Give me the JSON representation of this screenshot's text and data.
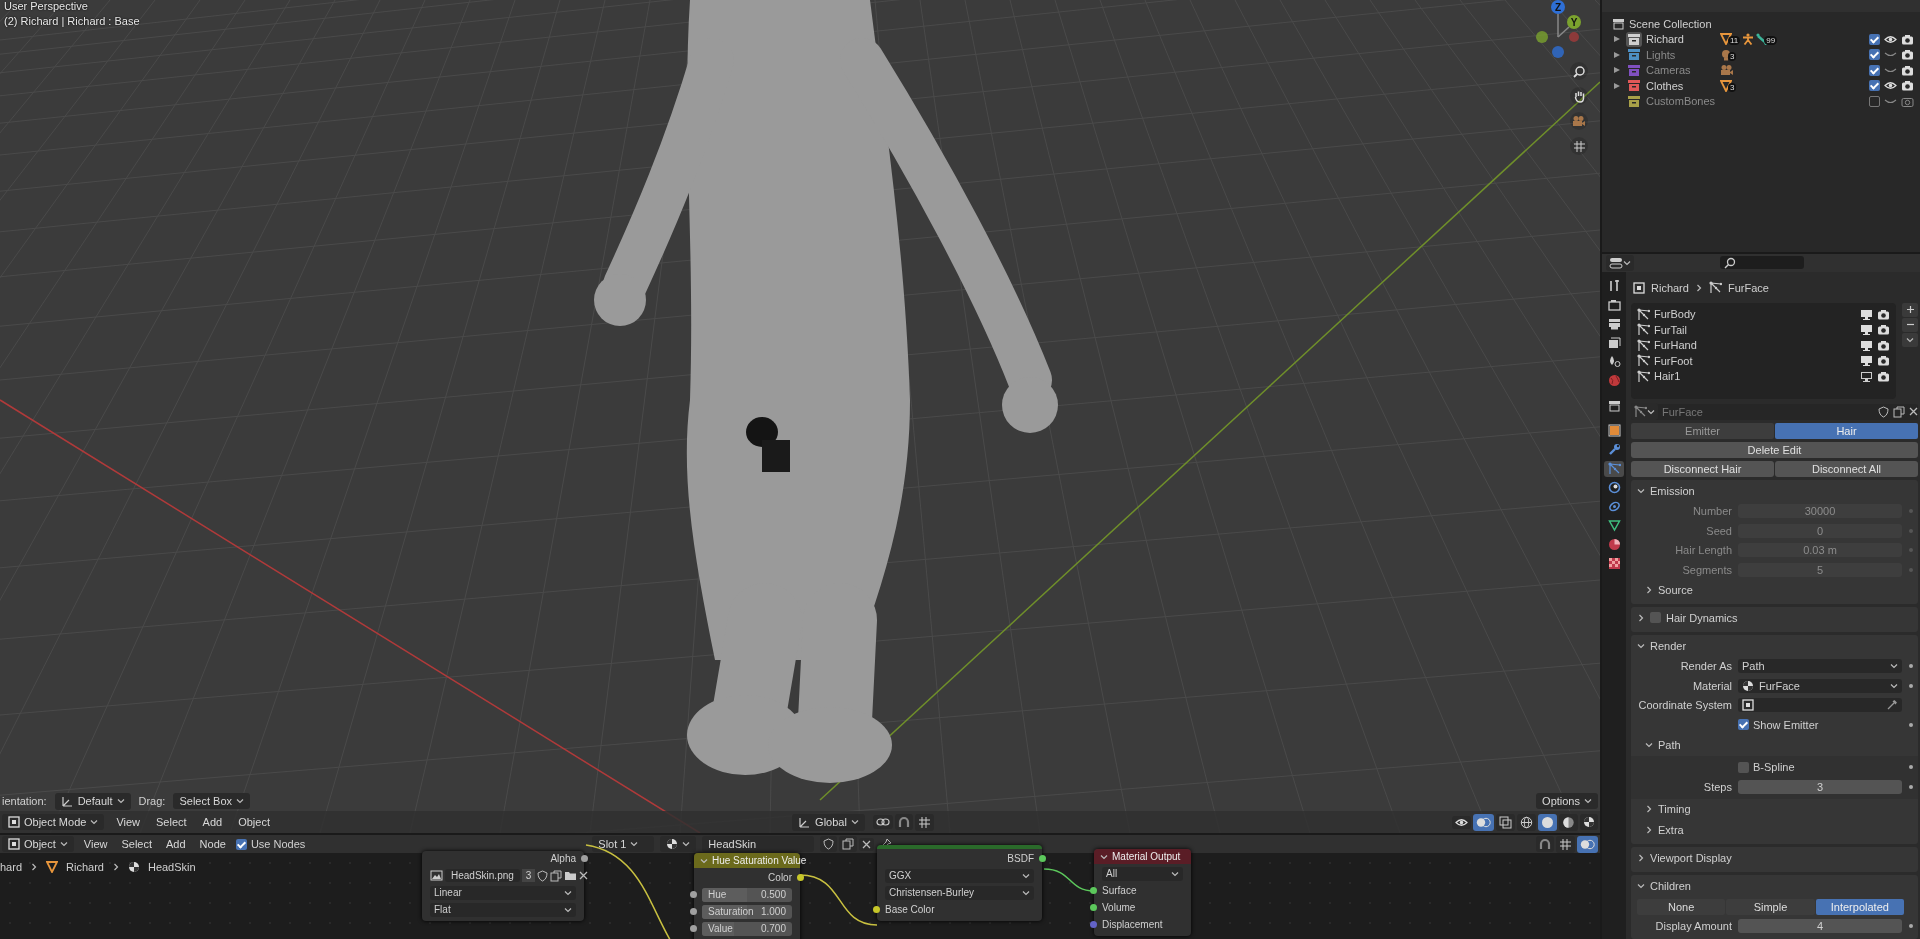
{
  "viewport": {
    "overlay": {
      "title": "User Perspective",
      "info": "(2) Richard | Richard : Base"
    },
    "gizmo": [
      {
        "label": "Z",
        "color": "#2e6fd6"
      },
      {
        "label": "Y",
        "color": "#7ba22e"
      }
    ],
    "tool_settings": {
      "orientation_label": "ientation:",
      "orientation": "Default",
      "drag_label": "Drag:",
      "drag": "Select Box",
      "options": "Options"
    },
    "header": {
      "mode": "Object Mode",
      "menus": [
        "View",
        "Select",
        "Add",
        "Object"
      ],
      "transform": "Global"
    }
  },
  "node_editor": {
    "header": {
      "editor": "Object",
      "menus": [
        "View",
        "Select",
        "Add",
        "Node"
      ],
      "use_nodes": {
        "label": "Use Nodes",
        "checked": true
      },
      "slot": "Slot 1",
      "material": "HeadSkin"
    },
    "breadcrumbs": [
      {
        "kind": "text",
        "label": "hard"
      },
      {
        "kind": "mesh",
        "label": "Richard"
      },
      {
        "kind": "material",
        "label": "HeadSkin"
      }
    ],
    "nodes": [
      {
        "kind": "image",
        "outputs": [
          "Alpha"
        ],
        "image": "HeadSkin.png",
        "users": "3",
        "fields": [
          "Linear",
          "Flat"
        ]
      },
      {
        "kind": "hsv",
        "title": "Hue Saturation Value",
        "outputs": [
          "Color"
        ],
        "values": [
          {
            "label": "Hue",
            "value": "0.500",
            "level": 0.5
          },
          {
            "label": "Saturation",
            "value": "1.000",
            "level": 0.5
          },
          {
            "label": "Value",
            "value": "0.700",
            "level": 0.35
          }
        ]
      },
      {
        "kind": "bsdf",
        "outputs": [
          "BSDF"
        ],
        "fields": [
          "GGX",
          "Christensen-Burley"
        ],
        "inputs": [
          "Base Color"
        ]
      },
      {
        "kind": "output",
        "title": "Material Output",
        "fields": [
          "All"
        ],
        "inputs": [
          "Surface",
          "Volume",
          "Displacement"
        ]
      }
    ]
  },
  "outliner": {
    "root": "Scene Collection",
    "items": [
      {
        "name": "Richard",
        "color": "#cfcfcf",
        "expandable": true,
        "active": true,
        "checked": true,
        "visible": true,
        "badges": [
          {
            "kind": "mesh",
            "count": "11"
          },
          {
            "kind": "armature"
          },
          {
            "kind": "bone",
            "count": "99"
          }
        ]
      },
      {
        "name": "Lights",
        "color": "#4d8fc4",
        "expandable": true,
        "active": false,
        "checked": true,
        "visible": false,
        "badges": [
          {
            "kind": "light",
            "count": "3"
          }
        ]
      },
      {
        "name": "Cameras",
        "color": "#8050c0",
        "expandable": true,
        "active": false,
        "checked": true,
        "visible": false,
        "badges": [
          {
            "kind": "camera"
          }
        ]
      },
      {
        "name": "Clothes",
        "color": "#e05858",
        "expandable": true,
        "active": false,
        "checked": true,
        "visible": true,
        "badges": [
          {
            "kind": "mesh",
            "count": "3"
          }
        ]
      },
      {
        "name": "CustomBones",
        "color": "#a8a048",
        "expandable": false,
        "active": false,
        "checked": false,
        "visible": false
      }
    ]
  },
  "properties": {
    "editor_tabs": [
      {
        "kind": "tool",
        "selected": false
      },
      {
        "kind": "render",
        "selected": false
      },
      {
        "kind": "output",
        "selected": false
      },
      {
        "kind": "view_layer",
        "selected": false
      },
      {
        "kind": "scene",
        "selected": false
      },
      {
        "kind": "world",
        "selected": false
      },
      {
        "kind": "collection",
        "selected": false
      },
      {
        "kind": "object",
        "selected": false
      },
      {
        "kind": "modifier",
        "selected": false
      },
      {
        "kind": "particles",
        "selected": true
      },
      {
        "kind": "physics",
        "selected": false
      },
      {
        "kind": "constraints",
        "selected": false
      },
      {
        "kind": "data",
        "selected": false
      },
      {
        "kind": "material",
        "selected": false
      },
      {
        "kind": "texture",
        "selected": false
      }
    ],
    "breadcrumb": [
      "Richard",
      "FurFace"
    ],
    "systems": [
      {
        "name": "FurBody",
        "show_viewport": true
      },
      {
        "name": "FurTail",
        "show_viewport": true
      },
      {
        "name": "FurHand",
        "show_viewport": true
      },
      {
        "name": "FurFoot",
        "show_viewport": true
      },
      {
        "name": "Hair1",
        "show_viewport": false
      }
    ],
    "name": "FurFace",
    "types": [
      {
        "label": "Emitter",
        "selected": false
      },
      {
        "label": "Hair",
        "selected": true
      }
    ],
    "buttons": [
      [
        "Delete Edit"
      ],
      [
        "Disconnect Hair",
        "Disconnect All"
      ]
    ],
    "panels": [
      {
        "title": "Emission",
        "expanded": true,
        "rows": [
          {
            "kind": "number",
            "label": "Number",
            "value": "30000",
            "disabled": true
          },
          {
            "kind": "number",
            "label": "Seed",
            "value": "0",
            "disabled": true
          },
          {
            "kind": "number",
            "label": "Hair Length",
            "value": "0.03 m",
            "disabled": true
          },
          {
            "kind": "number",
            "label": "Segments",
            "value": "5",
            "disabled": true
          },
          {
            "kind": "subpanel",
            "title": "Source",
            "expanded": false,
            "rows": []
          }
        ]
      },
      {
        "title": "Hair Dynamics",
        "expanded": false,
        "checkbox": false
      },
      {
        "title": "Render",
        "expanded": true,
        "rows": [
          {
            "kind": "dropdown",
            "label": "Render As",
            "value": "Path"
          },
          {
            "kind": "material",
            "label": "Material",
            "value": "FurFace"
          },
          {
            "kind": "picker",
            "label": "Coordinate System"
          },
          {
            "kind": "checkbox",
            "label": "Show Emitter",
            "checked": true
          },
          {
            "kind": "subpanel",
            "title": "Path",
            "expanded": true,
            "rows": [
              {
                "kind": "checkbox",
                "label": "B-Spline",
                "checked": false
              },
              {
                "kind": "number",
                "label": "Steps",
                "value": "3",
                "disabled": false
              }
            ]
          },
          {
            "kind": "subpanel",
            "title": "Timing",
            "expanded": false,
            "rows": []
          },
          {
            "kind": "subpanel",
            "title": "Extra",
            "expanded": false,
            "rows": []
          }
        ]
      },
      {
        "title": "Viewport Display",
        "expanded": false
      },
      {
        "title": "Children",
        "expanded": true,
        "rows": [
          {
            "kind": "segmented",
            "options": [
              {
                "label": "None",
                "selected": false
              },
              {
                "label": "Simple",
                "selected": false
              },
              {
                "label": "Interpolated",
                "selected": true
              }
            ]
          },
          {
            "kind": "number",
            "label": "Display Amount",
            "value": "4",
            "disabled": false
          }
        ]
      }
    ]
  }
}
